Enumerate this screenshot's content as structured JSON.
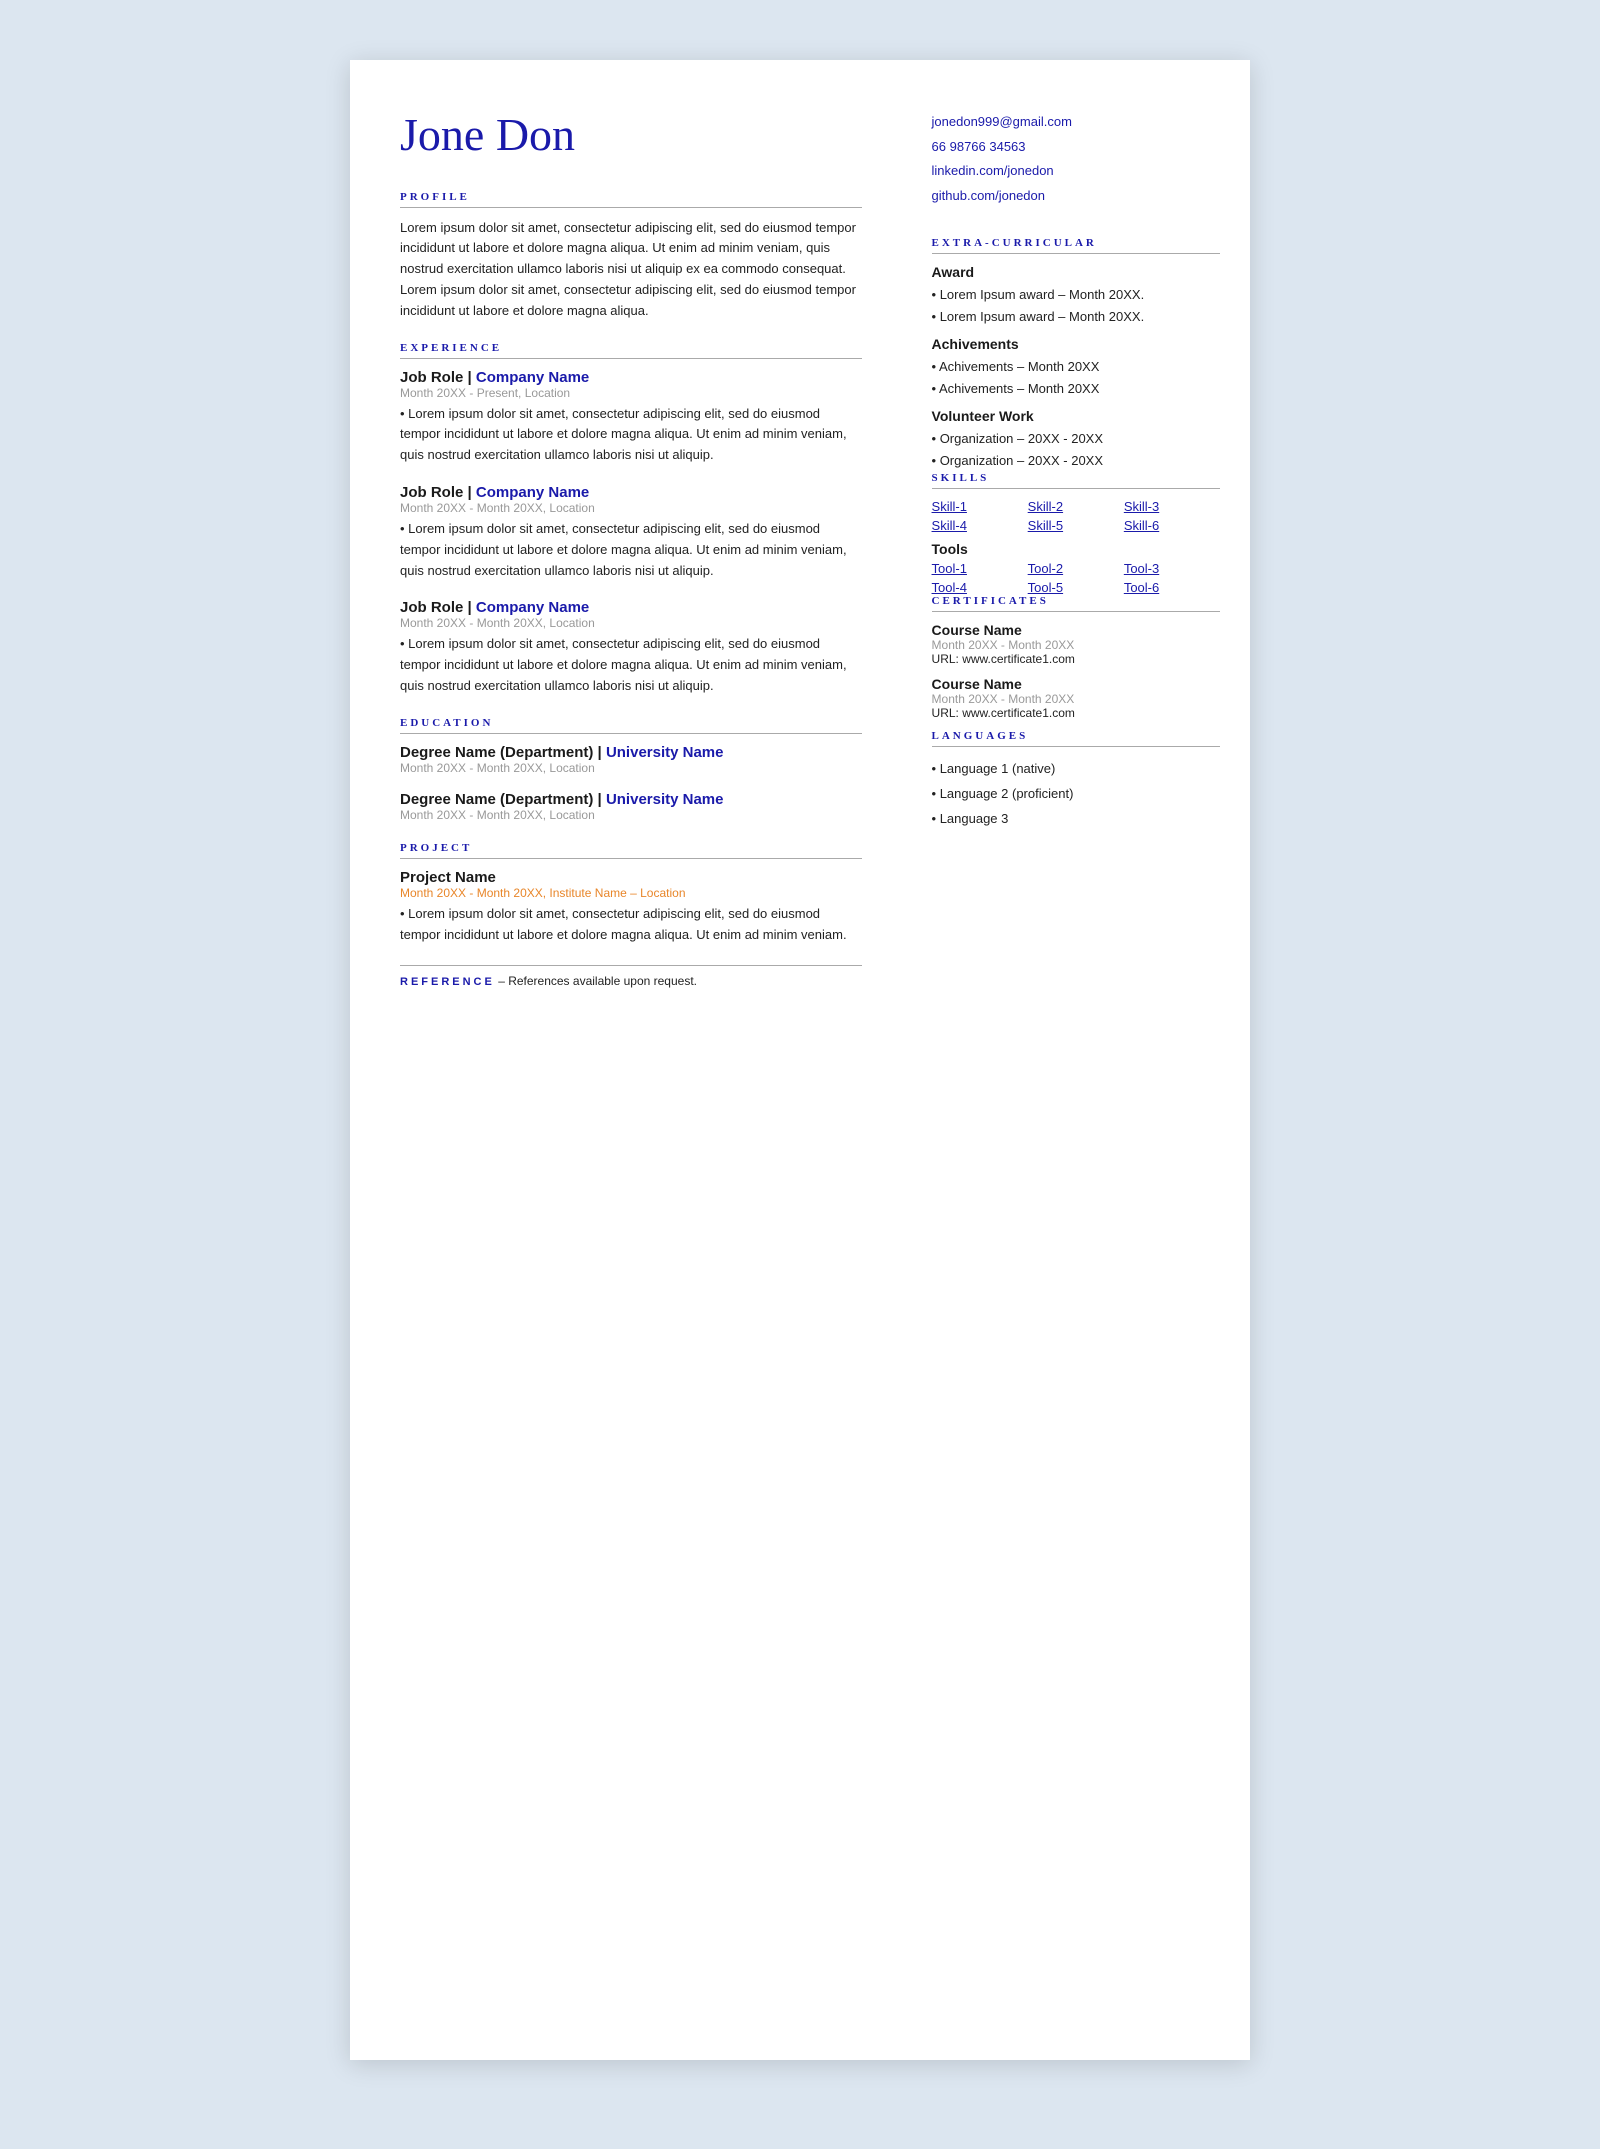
{
  "resume": {
    "name": "Jone Don",
    "contact": {
      "email": "jonedon999@gmail.com",
      "phone": "66 98766 34563",
      "linkedin": "linkedin.com/jonedon",
      "github": "github.com/jonedon"
    },
    "profile": {
      "section_title": "PROFILE",
      "text": "Lorem ipsum dolor sit amet, consectetur adipiscing elit, sed do eiusmod tempor incididunt ut labore et dolore magna aliqua. Ut enim ad minim veniam, quis nostrud exercitation ullamco laboris nisi ut aliquip ex ea commodo consequat. Lorem ipsum dolor sit amet, consectetur adipiscing elit, sed do eiusmod tempor incididunt ut labore et dolore magna aliqua."
    },
    "experience": {
      "section_title": "EXPERIENCE",
      "jobs": [
        {
          "role": "Job Role",
          "company": "Company Name",
          "date": "Month 20XX - Present, Location",
          "desc": "• Lorem ipsum dolor sit amet, consectetur adipiscing elit, sed do eiusmod tempor incididunt ut labore et dolore magna aliqua. Ut enim ad minim veniam, quis nostrud exercitation ullamco laboris nisi ut aliquip."
        },
        {
          "role": "Job Role",
          "company": "Company Name",
          "date": "Month 20XX - Month 20XX, Location",
          "desc": "• Lorem ipsum dolor sit amet, consectetur adipiscing elit, sed do eiusmod tempor incididunt ut labore et dolore magna aliqua. Ut enim ad minim veniam, quis nostrud exercitation ullamco laboris nisi ut aliquip."
        },
        {
          "role": "Job Role",
          "company": "Company Name",
          "date": "Month 20XX - Month 20XX, Location",
          "desc": "• Lorem ipsum dolor sit amet, consectetur adipiscing elit, sed do eiusmod tempor incididunt ut labore et dolore magna aliqua. Ut enim ad minim veniam, quis nostrud exercitation ullamco laboris nisi ut aliquip."
        }
      ]
    },
    "education": {
      "section_title": "EDUCATION",
      "entries": [
        {
          "degree": "Degree Name (Department)",
          "university": "University Name",
          "date": "Month 20XX - Month 20XX, Location"
        },
        {
          "degree": "Degree Name (Department)",
          "university": "University Name",
          "date": "Month 20XX - Month 20XX, Location"
        }
      ]
    },
    "project": {
      "section_title": "PROJECT",
      "entries": [
        {
          "name": "Project Name",
          "date": "Month 20XX - Month 20XX, Institute Name – Location",
          "desc": "• Lorem ipsum dolor sit amet, consectetur adipiscing elit, sed do eiusmod tempor incididunt ut labore et dolore magna aliqua. Ut enim ad minim veniam."
        }
      ]
    },
    "reference": {
      "label": "REFERENCE",
      "text": "– References available upon request."
    },
    "extra_curricular": {
      "section_title": "EXTRA-CURRICULAR",
      "award": {
        "title": "Award",
        "items": [
          "• Lorem Ipsum award – Month 20XX.",
          "• Lorem Ipsum award – Month 20XX."
        ]
      },
      "achievements": {
        "title": "Achivements",
        "items": [
          "• Achivements – Month 20XX",
          "• Achivements – Month 20XX"
        ]
      },
      "volunteer": {
        "title": "Volunteer Work",
        "items": [
          "• Organization – 20XX - 20XX",
          "• Organization – 20XX - 20XX"
        ]
      }
    },
    "skills": {
      "section_title": "SKILLS",
      "skills": [
        "Skill-1",
        "Skill-2",
        "Skill-3",
        "Skill-4",
        "Skill-5",
        "Skill-6"
      ],
      "tools_title": "Tools",
      "tools": [
        "Tool-1",
        "Tool-2",
        "Tool-3",
        "Tool-4",
        "Tool-5",
        "Tool-6"
      ]
    },
    "certificates": {
      "section_title": "CERTIFICATES",
      "entries": [
        {
          "name": "Course Name",
          "date": "Month 20XX - Month 20XX",
          "url": "URL: www.certificate1.com"
        },
        {
          "name": "Course Name",
          "date": "Month 20XX - Month 20XX",
          "url": "URL: www.certificate1.com"
        }
      ]
    },
    "languages": {
      "section_title": "LANGUAGES",
      "items": [
        "• Language 1 (native)",
        "• Language 2 (proficient)",
        "• Language 3"
      ]
    }
  }
}
